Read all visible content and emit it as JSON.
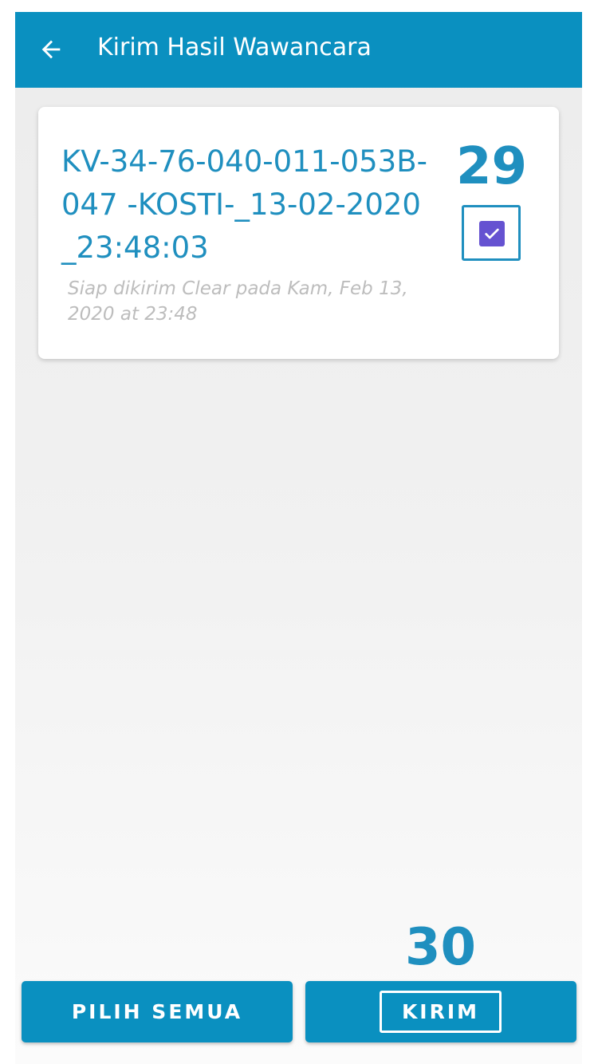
{
  "appbar": {
    "title": "Kirim Hasil Wawancara",
    "back_icon": "arrow-left-icon",
    "color": "#0a90c0"
  },
  "card": {
    "title": "KV-34-76-040-011-053B-047 -KOSTI-_13-02-2020_23:48:03",
    "subtitle": "Siap dikirim Clear pada Kam, Feb 13, 2020 at 23:48",
    "checked": true,
    "checkbox_color": "#6552d1"
  },
  "annotations": {
    "checkbox_label": "29",
    "send_label": "30"
  },
  "actions": {
    "select_all_label": "PILIH SEMUA",
    "send_label": "KIRIM"
  }
}
